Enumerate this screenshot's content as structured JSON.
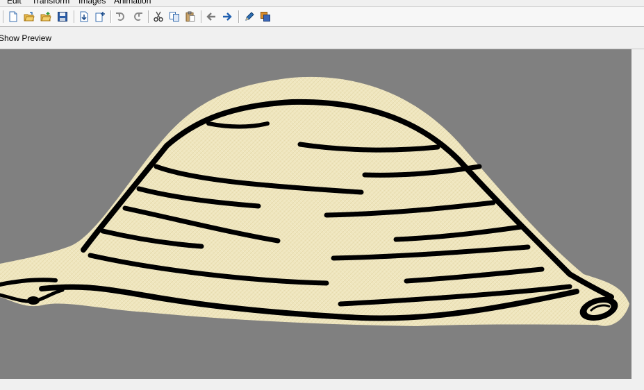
{
  "menu": {
    "items": [
      "Edit",
      "Transform",
      "Images",
      "Animation"
    ]
  },
  "toolbar": {
    "buttons": [
      {
        "name": "new-icon",
        "tip": ""
      },
      {
        "name": "open-icon",
        "tip": ""
      },
      {
        "name": "open-folder-icon",
        "tip": ""
      },
      {
        "name": "save-icon",
        "tip": ""
      },
      {
        "name": "import-icon",
        "tip": ""
      },
      {
        "name": "add-frame-icon",
        "tip": ""
      },
      {
        "name": "undo-icon",
        "tip": ""
      },
      {
        "name": "redo-icon",
        "tip": ""
      },
      {
        "name": "cut-icon",
        "tip": ""
      },
      {
        "name": "copy-icon",
        "tip": ""
      },
      {
        "name": "paste-icon",
        "tip": ""
      },
      {
        "name": "arrow-left-icon",
        "tip": ""
      },
      {
        "name": "arrow-right-icon",
        "tip": ""
      },
      {
        "name": "pencil-icon",
        "tip": ""
      },
      {
        "name": "layers-icon",
        "tip": ""
      }
    ]
  },
  "preview": {
    "label": "Show Preview"
  },
  "canvas": {
    "background": "#808080",
    "image": "cream textured hat-shaped sketch with thick black stripe lines",
    "paper_color": "#efe6bf",
    "ink_color": "#000000"
  }
}
